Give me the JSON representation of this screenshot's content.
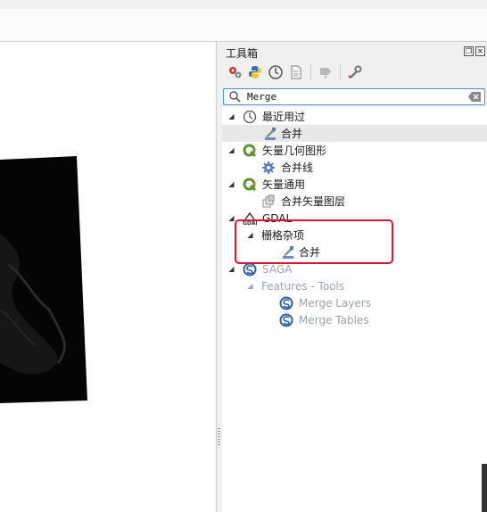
{
  "toolbox": {
    "title": "工具箱",
    "search_value": "Merge"
  },
  "tree": [
    {
      "label": "最近用过",
      "icon": "clock-icon",
      "group": true
    },
    {
      "label": "合并",
      "icon": "raster-merge-icon",
      "group": false,
      "selected": true
    },
    {
      "label": "矢量几何图形",
      "icon": "qgis-logo-icon",
      "group": true
    },
    {
      "label": "合并线",
      "icon": "gear-icon",
      "group": false
    },
    {
      "label": "矢量通用",
      "icon": "qgis-logo-icon",
      "group": true
    },
    {
      "label": "合并矢量图层",
      "icon": "layers-icon",
      "group": false
    },
    {
      "label": "GDAL",
      "icon": "gdal-logo-icon",
      "group": true
    },
    {
      "label": "栅格杂项",
      "icon": "",
      "group": true
    },
    {
      "label": "合并",
      "icon": "raster-merge-icon",
      "group": false
    },
    {
      "label": "SAGA",
      "icon": "saga-logo-icon",
      "group": true,
      "disabled": true
    },
    {
      "label": "Features - Tools",
      "icon": "",
      "group": true,
      "disabled": true
    },
    {
      "label": "Merge Layers",
      "icon": "saga-logo-icon",
      "group": false,
      "disabled": true
    },
    {
      "label": "Merge Tables",
      "icon": "saga-logo-icon",
      "group": false,
      "disabled": true
    }
  ],
  "colors": {
    "highlight_box": "#e0142e",
    "search_focus": "#4a90d9",
    "qgis_green": "#589632",
    "saga_blue": "#2a5fa8"
  }
}
